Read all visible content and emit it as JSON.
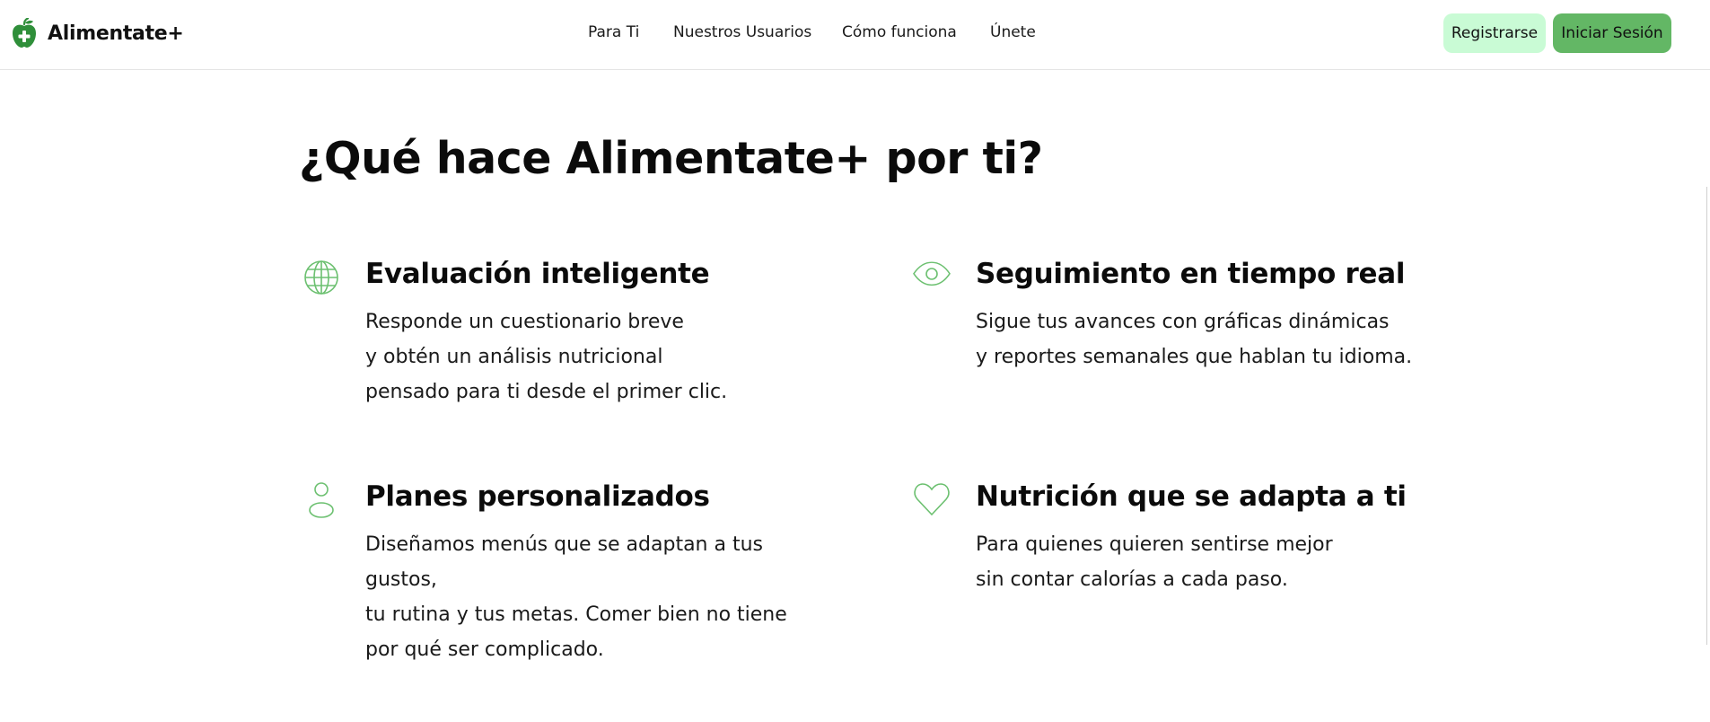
{
  "brand": {
    "name": "Alimentate+",
    "logo_icon": "apple-plus-icon",
    "logo_color": "#2f8f3a"
  },
  "nav": {
    "links": [
      "Para Ti",
      "Nuestros Usuarios",
      "Cómo funciona",
      "Únete"
    ]
  },
  "auth": {
    "register_label": "Registrarse",
    "login_label": "Iniciar Sesión",
    "register_color": "#c9fbd5",
    "login_color": "#63b765"
  },
  "section": {
    "title": "¿Qué hace Alimentate+ por ti?",
    "icon_color": "#6cc070",
    "features": [
      {
        "icon": "globe-icon",
        "title": "Evaluación inteligente",
        "lines": [
          "Responde un cuestionario breve",
          "y obtén un análisis nutricional",
          "pensado para ti desde el primer clic."
        ]
      },
      {
        "icon": "eye-icon",
        "title": "Seguimiento en tiempo real",
        "lines": [
          "Sigue tus avances con gráficas dinámicas",
          "y reportes semanales que hablan tu idioma."
        ]
      },
      {
        "icon": "user-icon",
        "title": "Planes personalizados",
        "lines": [
          "Diseñamos menús que se adaptan a tus",
          "gustos,",
          "tu rutina y tus metas. Comer bien no tiene",
          "por qué ser complicado."
        ]
      },
      {
        "icon": "heart-icon",
        "title": "Nutrición que se adapta a ti",
        "lines": [
          "Para quienes quieren sentirse mejor",
          "sin contar calorías a cada paso."
        ]
      }
    ]
  }
}
